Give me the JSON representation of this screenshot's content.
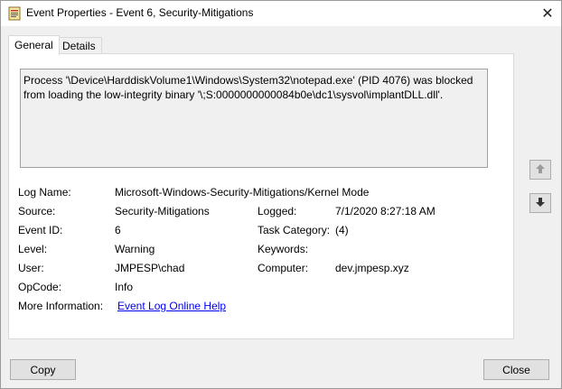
{
  "window": {
    "title": "Event Properties - Event 6, Security-Mitigations",
    "close_glyph": "✕"
  },
  "tabs": [
    {
      "label": "General",
      "active": true
    },
    {
      "label": "Details",
      "active": false
    }
  ],
  "message": "Process '\\Device\\HarddiskVolume1\\Windows\\System32\\notepad.exe' (PID 4076) was blocked\nfrom loading the low-integrity binary '\\;S:0000000000084b0e\\dc1\\sysvol\\implantDLL.dll'.",
  "fields": {
    "log_name": {
      "label": "Log Name:",
      "value": "Microsoft-Windows-Security-Mitigations/Kernel Mode"
    },
    "source": {
      "label": "Source:",
      "value": "Security-Mitigations"
    },
    "logged": {
      "label": "Logged:",
      "value": "7/1/2020 8:27:18 AM"
    },
    "event_id": {
      "label": "Event ID:",
      "value": "6"
    },
    "task_category": {
      "label": "Task Category:",
      "value": "(4)"
    },
    "level": {
      "label": "Level:",
      "value": "Warning"
    },
    "keywords": {
      "label": "Keywords:",
      "value": ""
    },
    "user": {
      "label": "User:",
      "value": "JMPESP\\chad"
    },
    "computer": {
      "label": "Computer:",
      "value": "dev.jmpesp.xyz"
    },
    "opcode": {
      "label": "OpCode:",
      "value": "Info"
    },
    "more_info": {
      "label": "More Information:",
      "link": "Event Log Online Help"
    }
  },
  "nav": {
    "up_icon": "arrow-up-icon",
    "down_icon": "arrow-down-icon"
  },
  "buttons": {
    "copy": "Copy",
    "close": "Close"
  }
}
